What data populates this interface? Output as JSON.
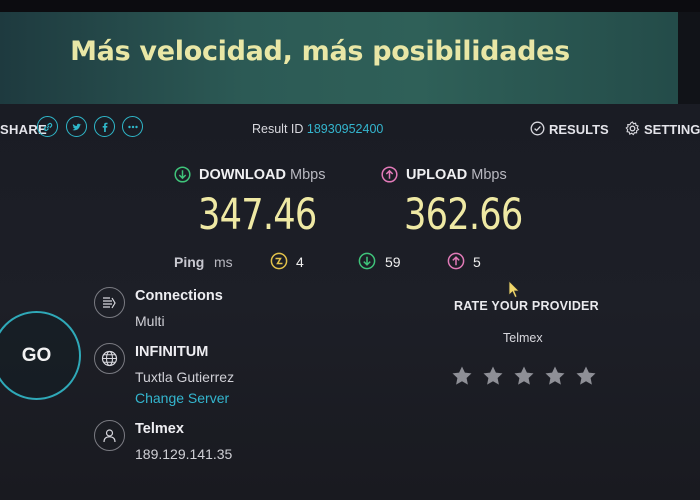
{
  "banner": {
    "title": "Más velocidad, más posibilidades"
  },
  "topbar": {
    "share_label": "SHARE",
    "share_icons": [
      "link-icon",
      "twitter-icon",
      "facebook-icon",
      "more-icon"
    ],
    "result_label": "Result ID",
    "result_id": "18930952400",
    "results_label": "RESULTS",
    "settings_label": "SETTINGS"
  },
  "download": {
    "label": "DOWNLOAD",
    "unit": "Mbps",
    "value": "347.46",
    "icon": "download-arrow-icon",
    "color": "#3fc47a"
  },
  "upload": {
    "label": "UPLOAD",
    "unit": "Mbps",
    "value": "362.66",
    "icon": "upload-arrow-icon",
    "color": "#e27ab8"
  },
  "ping": {
    "label": "Ping",
    "unit": "ms",
    "idle": "4",
    "download": "59",
    "upload": "5",
    "idle_color": "#e2c24a"
  },
  "go": {
    "label": "GO"
  },
  "connections": {
    "title": "Connections",
    "value": "Multi"
  },
  "server": {
    "name": "INFINITUM",
    "location": "Tuxtla Gutierrez",
    "change_label": "Change Server"
  },
  "provider": {
    "name": "Telmex",
    "ip": "189.129.141.35"
  },
  "rating": {
    "title": "RATE YOUR PROVIDER",
    "provider": "Telmex",
    "stars": 5,
    "selected": 0
  },
  "colors": {
    "accent": "#34b6cf",
    "value_yellow": "#efe9a4"
  }
}
